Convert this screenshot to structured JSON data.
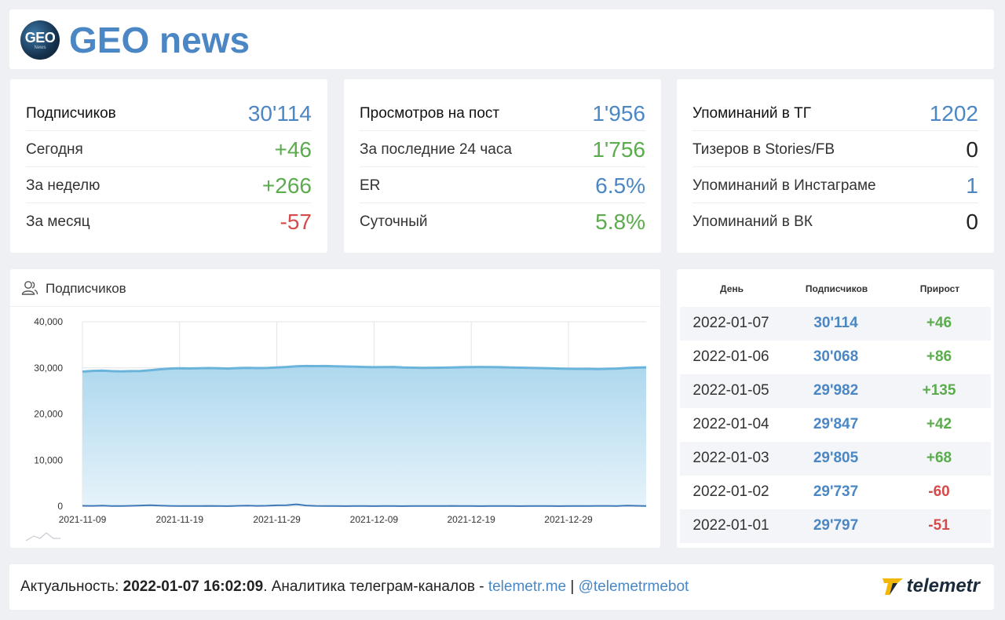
{
  "header": {
    "title": "GEO news",
    "logo_text": "GEO",
    "logo_sub": "News"
  },
  "stats": {
    "subscribers": [
      {
        "label": "Подписчиков",
        "value": "30'114",
        "color": "blue"
      },
      {
        "label": "Сегодня",
        "value": "+46",
        "color": "green"
      },
      {
        "label": "За неделю",
        "value": "+266",
        "color": "green"
      },
      {
        "label": "За месяц",
        "value": "-57",
        "color": "red"
      }
    ],
    "views": [
      {
        "label": "Просмотров на пост",
        "value": "1'956",
        "color": "blue"
      },
      {
        "label": "За последние 24 часа",
        "value": "1'756",
        "color": "green"
      },
      {
        "label": "ER",
        "value": "6.5%",
        "color": "blue"
      },
      {
        "label": "Суточный",
        "value": "5.8%",
        "color": "green"
      }
    ],
    "mentions": [
      {
        "label": "Упоминаний в ТГ",
        "value": "1202",
        "color": "blue"
      },
      {
        "label": "Тизеров в Stories/FB",
        "value": "0",
        "color": "dark"
      },
      {
        "label": "Упоминаний в Инстаграме",
        "value": "1",
        "color": "blue"
      },
      {
        "label": "Упоминаний в ВК",
        "value": "0",
        "color": "dark"
      }
    ]
  },
  "chart_card": {
    "title": "Подписчиков",
    "icon": "users-icon"
  },
  "chart_data": {
    "type": "area",
    "title": "Подписчиков",
    "x_ticks": [
      "2021-11-09",
      "2021-11-19",
      "2021-11-29",
      "2021-12-09",
      "2021-12-19",
      "2021-12-29"
    ],
    "x_start": "2021-11-09",
    "x_end": "2022-01-07",
    "y_ticks": [
      "0",
      "10,000",
      "20,000",
      "30,000",
      "40,000"
    ],
    "ylim": [
      0,
      40000
    ],
    "grid": true,
    "series": [
      {
        "name": "Подписчиков",
        "color": "#6ab4dc",
        "values": [
          29200,
          29350,
          29400,
          29300,
          29250,
          29300,
          29320,
          29500,
          29700,
          29850,
          29900,
          29880,
          29900,
          29950,
          29900,
          29850,
          29950,
          30000,
          29950,
          29980,
          30100,
          30200,
          30350,
          30400,
          30380,
          30400,
          30350,
          30300,
          30250,
          30200,
          30150,
          30180,
          30200,
          30100,
          30050,
          30000,
          30020,
          30050,
          30100,
          30150,
          30180,
          30200,
          30180,
          30150,
          30100,
          30050,
          30000,
          29950,
          29900,
          29850,
          29800,
          29780,
          29797,
          29737,
          29805,
          29847,
          29982,
          30068,
          30114
        ]
      },
      {
        "name": "Прирост",
        "color": "#3f79b8",
        "values": [
          80,
          60,
          120,
          40,
          30,
          90,
          150,
          200,
          140,
          60,
          40,
          30,
          50,
          60,
          40,
          20,
          80,
          120,
          60,
          100,
          180,
          220,
          400,
          150,
          60,
          40,
          30,
          20,
          30,
          40,
          20,
          30,
          40,
          20,
          30,
          50,
          40,
          30,
          60,
          40,
          30,
          20,
          30,
          40,
          30,
          20,
          30,
          40,
          30,
          20,
          30,
          40,
          51,
          60,
          68,
          42,
          135,
          86,
          46
        ]
      }
    ]
  },
  "table": {
    "headers": [
      "День",
      "Подписчиков",
      "Прирост"
    ],
    "rows": [
      {
        "date": "2022-01-07",
        "subs": "30'114",
        "gain": "+46",
        "color": "green"
      },
      {
        "date": "2022-01-06",
        "subs": "30'068",
        "gain": "+86",
        "color": "green"
      },
      {
        "date": "2022-01-05",
        "subs": "29'982",
        "gain": "+135",
        "color": "green"
      },
      {
        "date": "2022-01-04",
        "subs": "29'847",
        "gain": "+42",
        "color": "green"
      },
      {
        "date": "2022-01-03",
        "subs": "29'805",
        "gain": "+68",
        "color": "green"
      },
      {
        "date": "2022-01-02",
        "subs": "29'737",
        "gain": "-60",
        "color": "red"
      },
      {
        "date": "2022-01-01",
        "subs": "29'797",
        "gain": "-51",
        "color": "red"
      }
    ]
  },
  "footer": {
    "prefix": "Актуальность: ",
    "timestamp": "2022-01-07 16:02:09",
    "middle": ". Аналитика телеграм-каналов - ",
    "link1": "telemetr.me",
    "sep": " | ",
    "link2": "@telemetrmebot",
    "brand": "telemetr"
  },
  "colors": {
    "accent": "#4a87c4",
    "green": "#5aac4c",
    "red": "#d54a4a",
    "area": "#b9def2",
    "line": "#6ab4dc"
  }
}
